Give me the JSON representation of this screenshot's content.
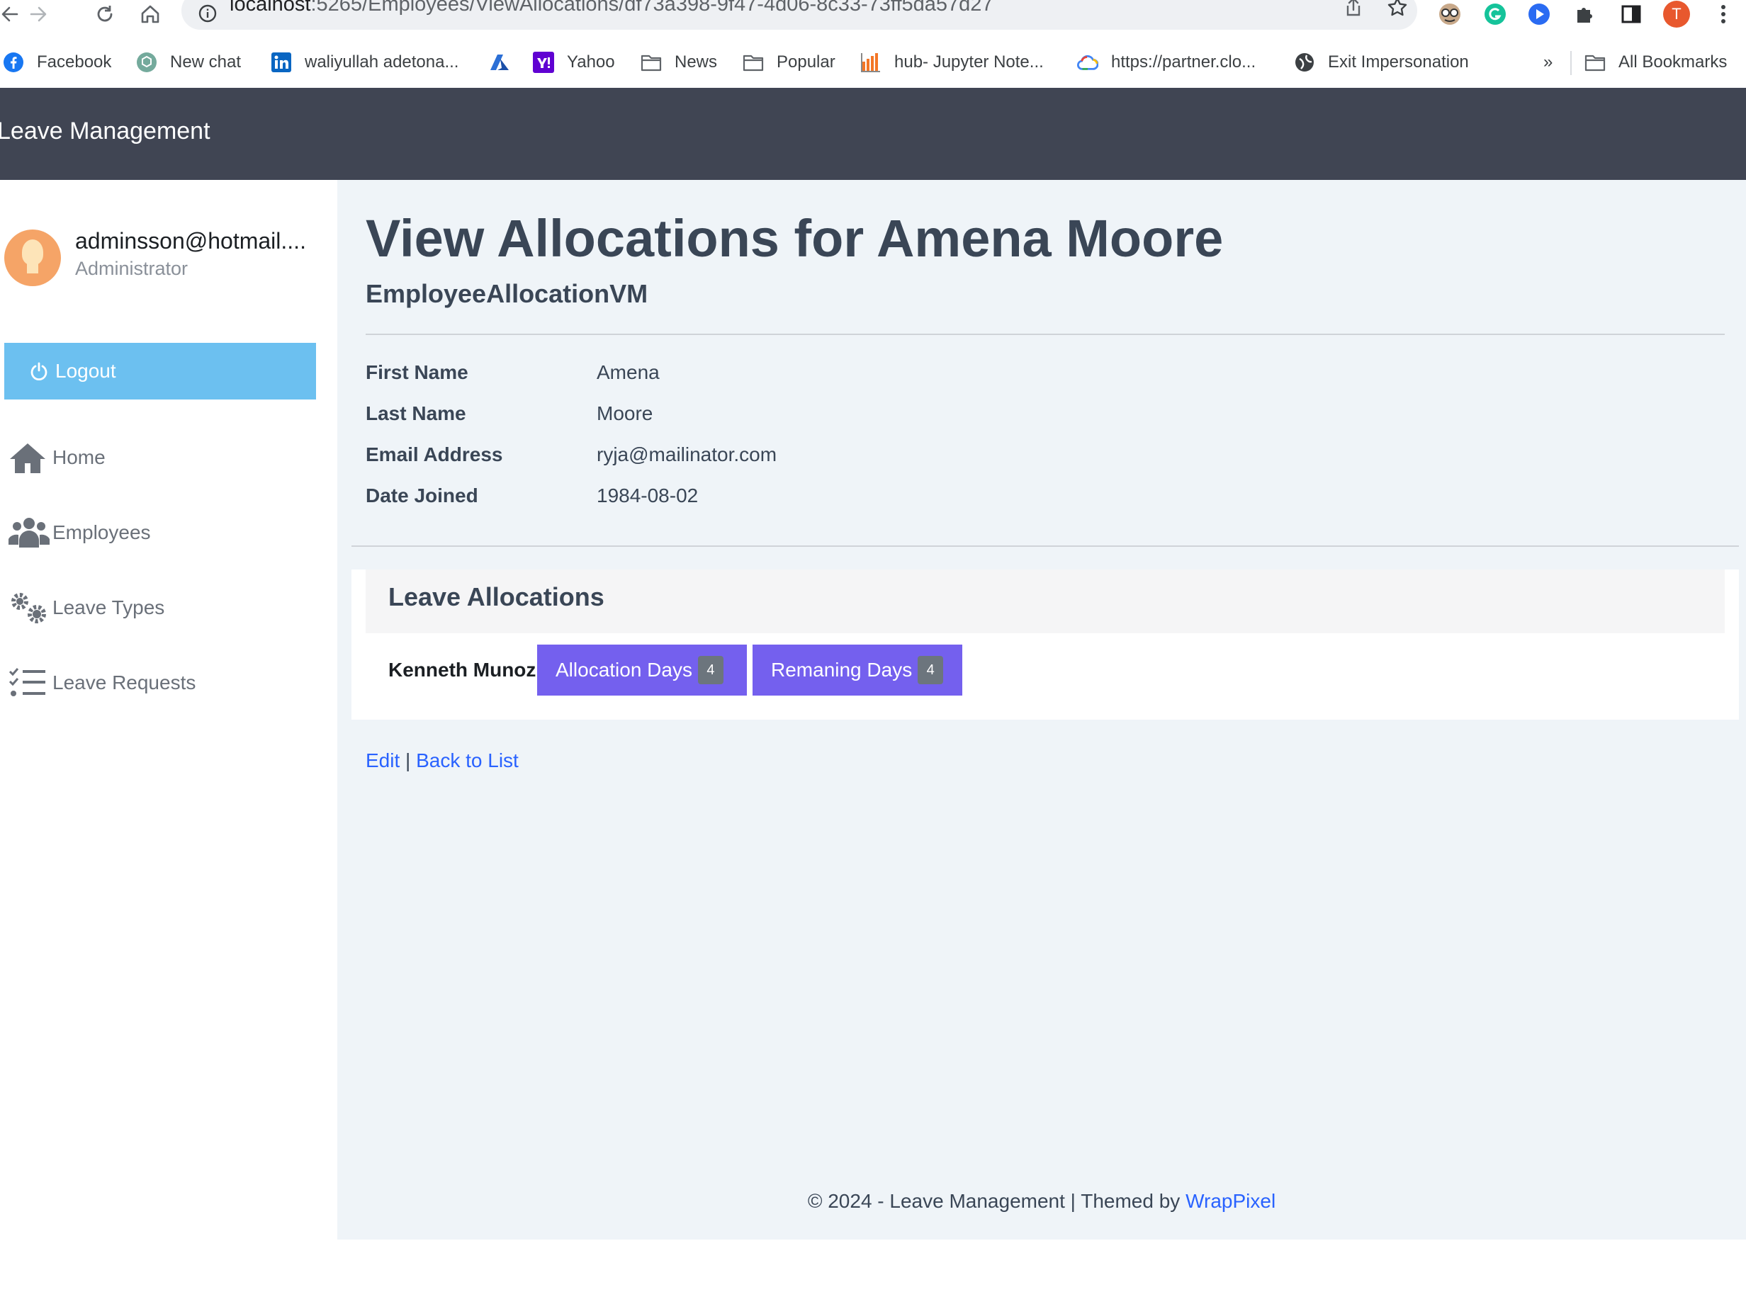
{
  "browser": {
    "url_host": "localhost",
    "url_path": ":5265/Employees/ViewAllocations/df73a398-9f47-4d06-8c33-73ff5da57d27",
    "profile_initial": "T",
    "bookmarks": [
      {
        "label": "Facebook",
        "icon": "facebook-icon"
      },
      {
        "label": "New chat",
        "icon": "chatgpt-icon"
      },
      {
        "label": "waliyullah adetona...",
        "icon": "linkedin-icon"
      },
      {
        "label": "",
        "icon": "azure-icon"
      },
      {
        "label": "Yahoo",
        "icon": "yahoo-icon"
      },
      {
        "label": "News",
        "icon": "folder-icon"
      },
      {
        "label": "Popular",
        "icon": "folder-icon"
      },
      {
        "label": "hub- Jupyter Note...",
        "icon": "jupyter-icon"
      },
      {
        "label": "https://partner.clo...",
        "icon": "google-cloud-icon"
      },
      {
        "label": "Exit Impersonation",
        "icon": "globe-icon"
      }
    ],
    "overflow_label": "»",
    "all_bookmarks": "All Bookmarks"
  },
  "app": {
    "brand": "Leave Management"
  },
  "sidebar": {
    "user_email": "adminsson@hotmail....",
    "user_role": "Administrator",
    "logout_label": "Logout",
    "items": [
      {
        "label": "Home",
        "icon": "home-icon"
      },
      {
        "label": "Employees",
        "icon": "users-icon"
      },
      {
        "label": "Leave Types",
        "icon": "gears-icon"
      },
      {
        "label": "Leave Requests",
        "icon": "checklist-icon"
      }
    ]
  },
  "main": {
    "title": "View Allocations for Amena Moore",
    "subtitle": "EmployeeAllocationVM",
    "details": [
      {
        "label": "First Name",
        "value": "Amena"
      },
      {
        "label": "Last Name",
        "value": "Moore"
      },
      {
        "label": "Email Address",
        "value": "ryja@mailinator.com"
      },
      {
        "label": "Date Joined",
        "value": "1984-08-02"
      }
    ],
    "allocations_heading": "Leave Allocations",
    "allocation": {
      "name": "Kenneth Munoz",
      "allocation_label": "Allocation Days",
      "allocation_value": "4",
      "remaining_label": "Remaning Days",
      "remaining_value": "4"
    },
    "edit_label": "Edit",
    "separator": "|",
    "back_label": "Back to List"
  },
  "footer": {
    "text": "© 2024 - Leave Management | Themed by",
    "link": "WrapPixel"
  },
  "colors": {
    "header_bg": "#404553",
    "main_bg": "#eff4f8",
    "logout_bg": "#6cc0f0",
    "pill_bg": "#7460ee",
    "link": "#2962ff"
  }
}
